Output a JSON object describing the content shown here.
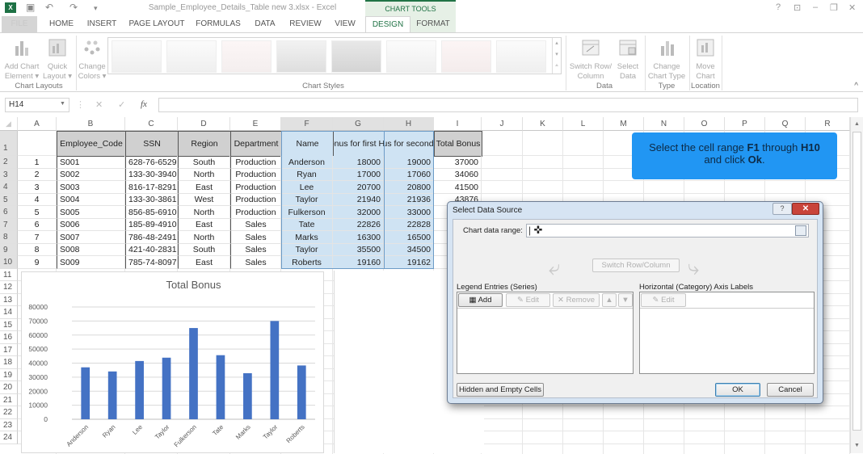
{
  "titlebar": {
    "doc_title": "Sample_Employee_Details_Table new 3.xlsx - Excel",
    "contextual_group": "CHART TOOLS",
    "logo": "X",
    "help": "?",
    "restore_ribbon": "⊡",
    "minimize": "–",
    "maximize": "❐",
    "close": "✕",
    "save_icon": "💾",
    "undo_icon": "↶",
    "redo_icon": "↷",
    "qat_more": "⩡"
  },
  "tabs": [
    {
      "label": "FILE"
    },
    {
      "label": "HOME"
    },
    {
      "label": "INSERT"
    },
    {
      "label": "PAGE LAYOUT"
    },
    {
      "label": "FORMULAS"
    },
    {
      "label": "DATA"
    },
    {
      "label": "REVIEW"
    },
    {
      "label": "VIEW"
    },
    {
      "label": "DESIGN",
      "active": true
    },
    {
      "label": "FORMAT"
    }
  ],
  "ribbon": {
    "add_chart_element": "Add Chart Element ▾",
    "quick_layout": "Quick Layout ▾",
    "change_colors": "Change Colors ▾",
    "switch_row_column": "Switch Row/ Column",
    "select_data": "Select Data",
    "change_chart_type": "Change Chart Type",
    "move_chart": "Move Chart",
    "groups": {
      "chart_layouts": "Chart Layouts",
      "chart_styles": "Chart Styles",
      "data": "Data",
      "type": "Type",
      "location": "Location"
    },
    "collapse": "^"
  },
  "formula_bar": {
    "name_box": "H14",
    "cancel": "✕",
    "enter": "✓",
    "fx": "fx",
    "formula": ""
  },
  "sheet": {
    "columns": [
      "A",
      "B",
      "C",
      "D",
      "E",
      "F",
      "G",
      "H",
      "I",
      "J",
      "K",
      "L",
      "M",
      "N",
      "O",
      "P",
      "Q",
      "R"
    ],
    "rows": [
      "1",
      "2",
      "3",
      "4",
      "5",
      "6",
      "7",
      "8",
      "9",
      "10",
      "11",
      "12",
      "13",
      "14",
      "15",
      "16",
      "17",
      "18",
      "19",
      "20",
      "21",
      "22",
      "23",
      "24"
    ],
    "headers": [
      "Employee_Code",
      "SSN",
      "Region",
      "Department",
      "Name",
      "Bonus for first Half",
      "Bonus for second Half",
      "Total Bonus"
    ],
    "records": [
      {
        "no": "1",
        "code": "S001",
        "ssn": "628-76-6529",
        "region": "South",
        "dept": "Production",
        "name": "Anderson",
        "h1": "18000",
        "h2": "19000",
        "total": "37000"
      },
      {
        "no": "2",
        "code": "S002",
        "ssn": "133-30-3940",
        "region": "North",
        "dept": "Production",
        "name": "Ryan",
        "h1": "17000",
        "h2": "17060",
        "total": "34060"
      },
      {
        "no": "3",
        "code": "S003",
        "ssn": "816-17-8291",
        "region": "East",
        "dept": "Production",
        "name": "Lee",
        "h1": "20700",
        "h2": "20800",
        "total": "41500"
      },
      {
        "no": "4",
        "code": "S004",
        "ssn": "133-30-3861",
        "region": "West",
        "dept": "Production",
        "name": "Taylor",
        "h1": "21940",
        "h2": "21936",
        "total": "43876"
      },
      {
        "no": "5",
        "code": "S005",
        "ssn": "856-85-6910",
        "region": "North",
        "dept": "Production",
        "name": "Fulkerson",
        "h1": "32000",
        "h2": "33000",
        "total": ""
      },
      {
        "no": "6",
        "code": "S006",
        "ssn": "185-89-4910",
        "region": "East",
        "dept": "Sales",
        "name": "Tate",
        "h1": "22826",
        "h2": "22828",
        "total": ""
      },
      {
        "no": "7",
        "code": "S007",
        "ssn": "786-48-2491",
        "region": "North",
        "dept": "Sales",
        "name": "Marks",
        "h1": "16300",
        "h2": "16500",
        "total": ""
      },
      {
        "no": "8",
        "code": "S008",
        "ssn": "421-40-2831",
        "region": "South",
        "dept": "Sales",
        "name": "Taylor",
        "h1": "35500",
        "h2": "34500",
        "total": ""
      },
      {
        "no": "9",
        "code": "S009",
        "ssn": "785-74-8097",
        "region": "East",
        "dept": "Sales",
        "name": "Roberts",
        "h1": "19160",
        "h2": "19162",
        "total": ""
      }
    ]
  },
  "callout": {
    "text_1": "Select the cell range ",
    "bold_1": "F1",
    "text_2": " through ",
    "bold_2": "H10",
    "text_3": "and click ",
    "bold_3": "Ok",
    "text_4": "."
  },
  "dialog": {
    "title": "Select Data Source",
    "help": "?",
    "close": "✕",
    "chart_data_range_label": "Chart data range:",
    "chart_data_range_value": "|",
    "switch_row_column": "Switch Row/Column",
    "legend_entries_label": "Legend Entries (Series)",
    "axis_labels_label": "Horizontal (Category) Axis Labels",
    "add": "Add",
    "edit": "Edit",
    "remove": "Remove",
    "move_up": "▲",
    "move_down": "▼",
    "axis_edit": "Edit",
    "hidden_empty_cells": "Hidden and Empty Cells",
    "ok": "OK",
    "cancel": "Cancel"
  },
  "chart_data": {
    "type": "bar",
    "title": "Total Bonus",
    "categories": [
      "Anderson",
      "Ryan",
      "Lee",
      "Taylor",
      "Fulkerson",
      "Tate",
      "Marks",
      "Taylor",
      "Roberts"
    ],
    "values": [
      37000,
      34060,
      41500,
      43876,
      65000,
      45654,
      32800,
      70000,
      38322
    ],
    "xlabel": "",
    "ylabel": "",
    "ylim": [
      0,
      80000
    ],
    "yticks": [
      "0",
      "10000",
      "20000",
      "30000",
      "40000",
      "50000",
      "60000",
      "70000",
      "80000"
    ],
    "grid": true,
    "legend": "none",
    "bar_color": "#4472c4"
  },
  "colors": {
    "accent": "#217346",
    "callout": "#2196f3",
    "selection": "#cfe3f3"
  }
}
